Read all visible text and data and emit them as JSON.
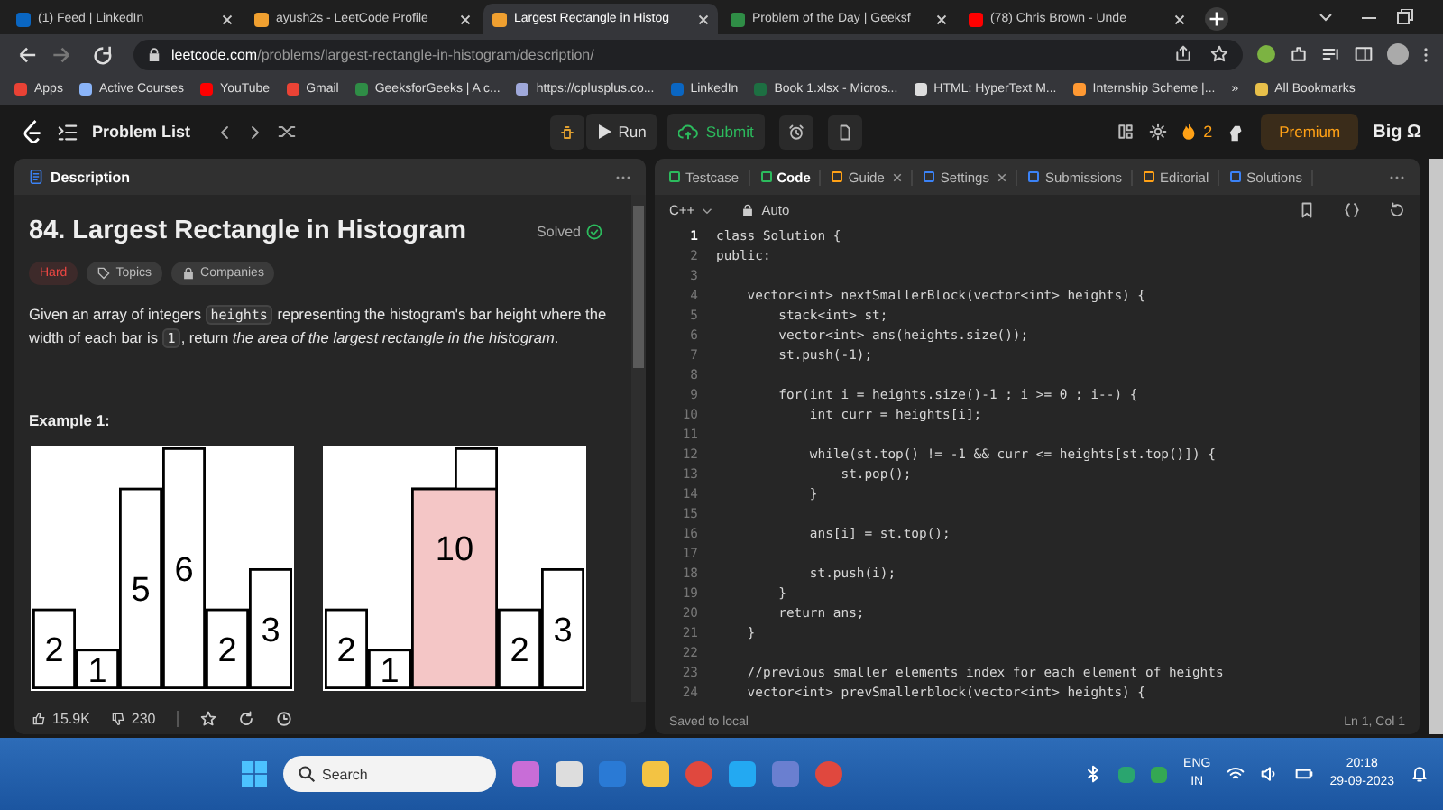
{
  "browser": {
    "tabs": [
      {
        "title": "(1) Feed | LinkedIn",
        "kind": "linkedin",
        "selected": false
      },
      {
        "title": "ayush2s - LeetCode Profile",
        "kind": "leetcode",
        "selected": false
      },
      {
        "title": "Largest Rectangle in Histog",
        "kind": "leetcode",
        "selected": true
      },
      {
        "title": "Problem of the Day | Geeksf",
        "kind": "gfg",
        "selected": false
      },
      {
        "title": "(78) Chris Brown - Unde",
        "kind": "youtube",
        "selected": false
      }
    ],
    "host": "leetcode.com",
    "path": "/problems/largest-rectangle-in-histogram/description/",
    "bookmarks": [
      {
        "label": "Apps",
        "kind": "apps"
      },
      {
        "label": "Active Courses",
        "kind": "circle"
      },
      {
        "label": "YouTube",
        "kind": "youtube"
      },
      {
        "label": "Gmail",
        "kind": "gmail"
      },
      {
        "label": "GeeksforGeeks | A c...",
        "kind": "gfg"
      },
      {
        "label": "https://cplusplus.co...",
        "kind": "cpp"
      },
      {
        "label": "LinkedIn",
        "kind": "linkedin"
      },
      {
        "label": "Book 1.xlsx - Micros...",
        "kind": "excel"
      },
      {
        "label": "HTML: HyperText M...",
        "kind": "mdn"
      },
      {
        "label": "Internship Scheme |...",
        "kind": "flag"
      }
    ],
    "overflow": "»",
    "all_bookmarks": "All Bookmarks"
  },
  "header": {
    "problem_list": "Problem List",
    "run": "Run",
    "submit": "Submit",
    "streak": "2",
    "premium": "Premium",
    "user": "Big Ω"
  },
  "description": {
    "tab": "Description",
    "title": "84. Largest Rectangle in Histogram",
    "status": "Solved",
    "tags": [
      {
        "label": "Hard",
        "kind": "difficulty"
      },
      {
        "label": "Topics",
        "kind": "topics"
      },
      {
        "label": "Companies",
        "kind": "companies"
      }
    ],
    "paragraph": [
      {
        "kind": "text",
        "text": "Given an array of integers "
      },
      {
        "kind": "code",
        "text": "heights"
      },
      {
        "kind": "text",
        "text": " representing the histogram's bar height where the width of each bar is "
      },
      {
        "kind": "code",
        "text": "1"
      },
      {
        "kind": "text",
        "text": ", return "
      },
      {
        "kind": "italic",
        "text": "the area of the largest rectangle in the histogram"
      },
      {
        "kind": "text",
        "text": "."
      }
    ],
    "example_heading": "Example 1:",
    "figures": [
      {
        "chart_data": {
          "type": "bar",
          "categories": [
            null,
            null,
            null,
            null,
            null,
            null
          ],
          "series": [
            {
              "color": "#ffffff",
              "values": [
                2,
                1,
                5,
                6,
                2,
                3
              ]
            }
          ],
          "data_labels": true
        }
      },
      {
        "bar_labels": [
          "2",
          "1",
          "2",
          "3"
        ],
        "area_label": "10"
      }
    ],
    "likes": "15.9K",
    "dislikes": "230"
  },
  "editor": {
    "tabs": [
      {
        "label": "Testcase",
        "kind": "testcase",
        "selected": false,
        "closable": false
      },
      {
        "label": "Code",
        "kind": "code",
        "selected": true,
        "closable": false
      },
      {
        "label": "Guide",
        "kind": "guide",
        "selected": false,
        "closable": true
      },
      {
        "label": "Settings",
        "kind": "settings",
        "selected": false,
        "closable": true
      },
      {
        "label": "Submissions",
        "kind": "submissions",
        "selected": false,
        "closable": false
      },
      {
        "label": "Editorial",
        "kind": "editorial",
        "selected": false,
        "closable": false
      },
      {
        "label": "Solutions",
        "kind": "solutions",
        "selected": false,
        "closable": false
      }
    ],
    "language": "C++",
    "mode": "Auto",
    "lines": [
      {
        "n": "1",
        "code": "class Solution {",
        "current": true
      },
      {
        "n": "2",
        "code": "public:",
        "current": false
      },
      {
        "n": "3",
        "current": false
      },
      {
        "n": "4",
        "code": "    vector<int> nextSmallerBlock(vector<int> heights) {",
        "current": false
      },
      {
        "n": "5",
        "code": "        stack<int> st;",
        "current": false
      },
      {
        "n": "6",
        "code": "        vector<int> ans(heights.size());",
        "current": false
      },
      {
        "n": "7",
        "code": "        st.push(-1);",
        "current": false
      },
      {
        "n": "8",
        "current": false
      },
      {
        "n": "9",
        "code": "        for(int i = heights.size()-1 ; i >= 0 ; i--) {",
        "current": false
      },
      {
        "n": "10",
        "code": "            int curr = heights[i];",
        "current": false
      },
      {
        "n": "11",
        "current": false
      },
      {
        "n": "12",
        "code": "            while(st.top() != -1 && curr <= heights[st.top()]) {",
        "current": false
      },
      {
        "n": "13",
        "code": "                st.pop();",
        "current": false
      },
      {
        "n": "14",
        "code": "            }",
        "current": false
      },
      {
        "n": "15",
        "current": false
      },
      {
        "n": "16",
        "code": "            ans[i] = st.top();",
        "current": false
      },
      {
        "n": "17",
        "current": false
      },
      {
        "n": "18",
        "code": "            st.push(i);",
        "current": false
      },
      {
        "n": "19",
        "code": "        }",
        "current": false
      },
      {
        "n": "20",
        "code": "        return ans;",
        "current": false
      },
      {
        "n": "21",
        "code": "    }",
        "current": false
      },
      {
        "n": "22",
        "current": false
      },
      {
        "n": "23",
        "code": "    //previous smaller elements index for each element of heights",
        "current": false
      },
      {
        "n": "24",
        "code": "    vector<int> prevSmallerblock(vector<int> heights) {",
        "current": false
      }
    ],
    "status": "Saved to local",
    "cursor": "Ln 1, Col 1"
  },
  "taskbar": {
    "search": {
      "placeholder": "Search"
    },
    "language": "ENG",
    "region": "IN",
    "time": "20:18",
    "date": "29-09-2023"
  }
}
